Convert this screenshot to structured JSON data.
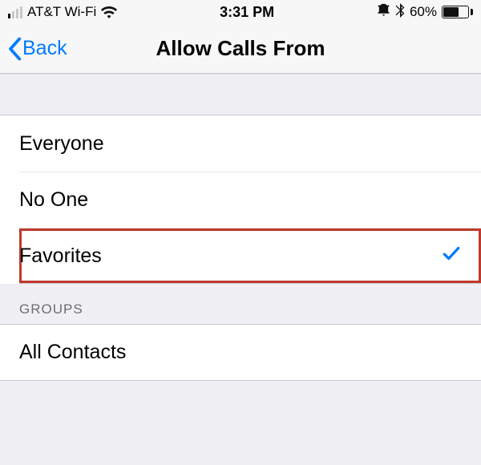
{
  "status": {
    "carrier": "AT&T Wi-Fi",
    "time": "3:31 PM",
    "battery_percent": "60%"
  },
  "nav": {
    "back_label": "Back",
    "title": "Allow Calls From"
  },
  "section1": {
    "items": [
      {
        "label": "Everyone",
        "selected": false
      },
      {
        "label": "No One",
        "selected": false
      },
      {
        "label": "Favorites",
        "selected": true,
        "highlighted": true
      }
    ]
  },
  "section2": {
    "header": "GROUPS",
    "items": [
      {
        "label": "All Contacts",
        "selected": false
      }
    ]
  },
  "colors": {
    "tint": "#007aff",
    "highlight": "#c0392b",
    "separator": "#c8c7cc",
    "bg": "#efeff4"
  }
}
